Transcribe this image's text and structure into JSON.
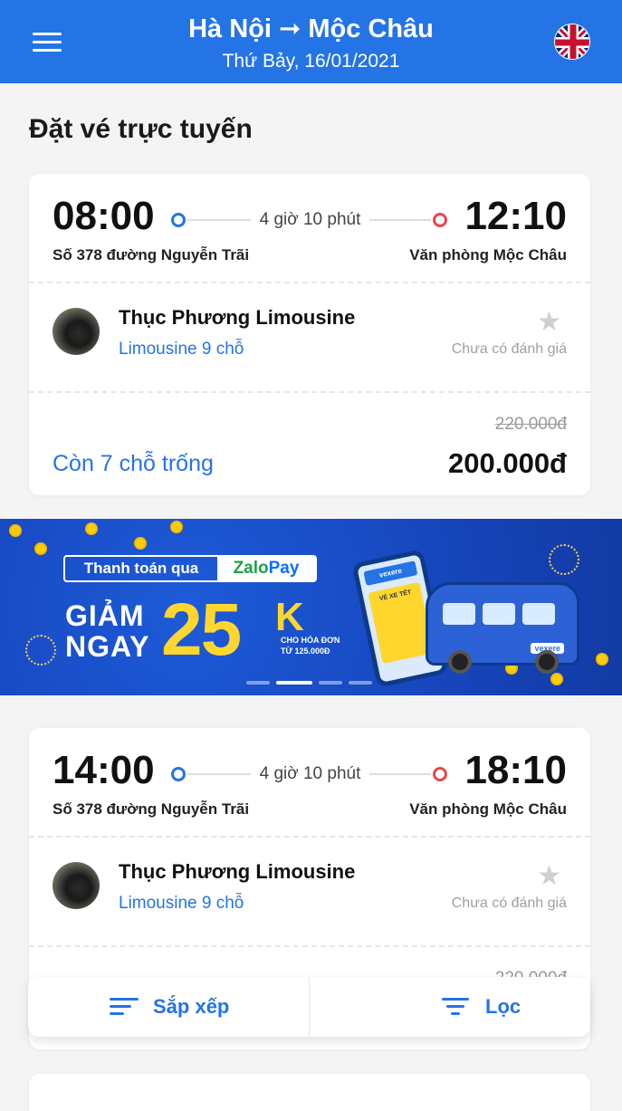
{
  "header": {
    "route": "Hà Nội ➞ Mộc Châu",
    "date": "Thứ Bảy, 16/01/2021",
    "menu_icon": "hamburger-menu-icon",
    "language_icon": "uk-flag-icon"
  },
  "section_title": "Đặt vé trực tuyến",
  "trips": [
    {
      "departure_time": "08:00",
      "arrival_time": "12:10",
      "duration": "4 giờ 10 phút",
      "departure_place": "Số 378 đường Nguyễn Trãi",
      "arrival_place": "Văn phòng Mộc Châu",
      "operator": "Thục Phương Limousine",
      "vehicle": "Limousine 9 chỗ",
      "rating": "Chưa có đánh giá",
      "old_price": "220.000đ",
      "seats": "Còn 7 chỗ trống",
      "price": "200.000đ"
    },
    {
      "departure_time": "14:00",
      "arrival_time": "18:10",
      "duration": "4 giờ 10 phút",
      "departure_place": "Số 378 đường Nguyễn Trãi",
      "arrival_place": "Văn phòng Mộc Châu",
      "operator": "Thục Phương Limousine",
      "vehicle": "Limousine 9 chỗ",
      "rating": "Chưa có đánh giá",
      "old_price": "220.000đ"
    }
  ],
  "banner": {
    "pay_label": "Thanh toán qua",
    "brand_zalo": "Zalo",
    "brand_pay": "Pay",
    "headline_line1": "GIẢM",
    "headline_line2": "NGAY",
    "amount": "25",
    "amount_unit": "K",
    "condition_line1": "CHO HÓA ĐƠN",
    "condition_line2": "TỪ 125.000Đ",
    "phone_header": "vexere",
    "ticket_text": "VÉ XE TẾT",
    "bus_logo": "vexere",
    "slide_count": 4,
    "active_slide": 2
  },
  "bottom_bar": {
    "sort_label": "Sắp xếp",
    "filter_label": "Lọc",
    "sort_icon": "sort-icon",
    "filter_icon": "filter-icon"
  },
  "colors": {
    "primary": "#2474e5",
    "arrival_dot": "#e5484d",
    "banner_yellow": "#ffd62e"
  }
}
